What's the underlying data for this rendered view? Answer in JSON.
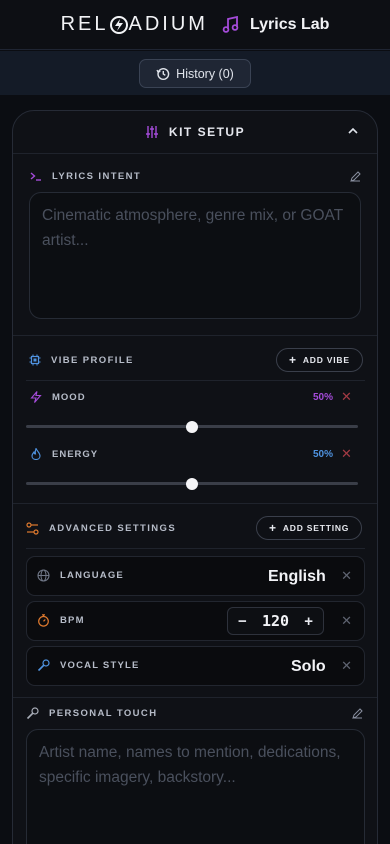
{
  "header": {
    "brand": "RELOADIUM",
    "brand_pre": "REL",
    "brand_post": "ADIUM",
    "app_title": "Lyrics Lab"
  },
  "history": {
    "label": "History (0)"
  },
  "kit": {
    "title": "KIT SETUP",
    "lyrics_intent": {
      "label": "LYRICS INTENT",
      "placeholder": "Cinematic atmosphere, genre mix, or GOAT artist..."
    },
    "vibe_profile": {
      "label": "VIBE PROFILE",
      "add_label": "ADD VIBE",
      "sliders": [
        {
          "name": "MOOD",
          "value_text": "50%",
          "value": 0.5,
          "color": "#a44bd9"
        },
        {
          "name": "ENERGY",
          "value_text": "50%",
          "value": 0.5,
          "color": "#4f93e0"
        }
      ]
    },
    "advanced": {
      "label": "ADVANCED SETTINGS",
      "add_label": "ADD SETTING",
      "language": {
        "label": "LANGUAGE",
        "value": "English"
      },
      "bpm": {
        "label": "BPM",
        "value": "120",
        "minus": "−",
        "plus": "+"
      },
      "vocal_style": {
        "label": "VOCAL STYLE",
        "value": "Solo"
      }
    },
    "personal_touch": {
      "label": "PERSONAL TOUCH",
      "placeholder": "Artist name, names to mention, dedications, specific imagery, backstory..."
    }
  },
  "colors": {
    "accent_purple": "#a44bd9",
    "accent_blue": "#4f93e0",
    "accent_orange": "#e07a2e",
    "remove_red": "#a33a44"
  }
}
